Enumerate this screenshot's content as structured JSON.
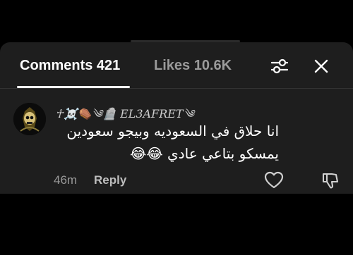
{
  "tabs": {
    "comments_label": "Comments 421",
    "likes_label": "Likes 10.6K"
  },
  "comment": {
    "username": "☥☠️⚰️༄🪦 EL3AFRET༄",
    "text_line1": "انا حلاق في السعوديه وبيجو سعودين",
    "text_line2": "يمسكو بتاعي عادي 😂😂",
    "time": "46m",
    "reply_label": "Reply"
  },
  "icons": {
    "filter": "sliders-icon",
    "close": "close-icon",
    "like": "heart-icon",
    "dislike": "thumbs-down-icon"
  },
  "colors": {
    "sheet_bg": "#1e1e1e",
    "inactive_tab": "#9a9a9a",
    "text": "#ffffff"
  }
}
